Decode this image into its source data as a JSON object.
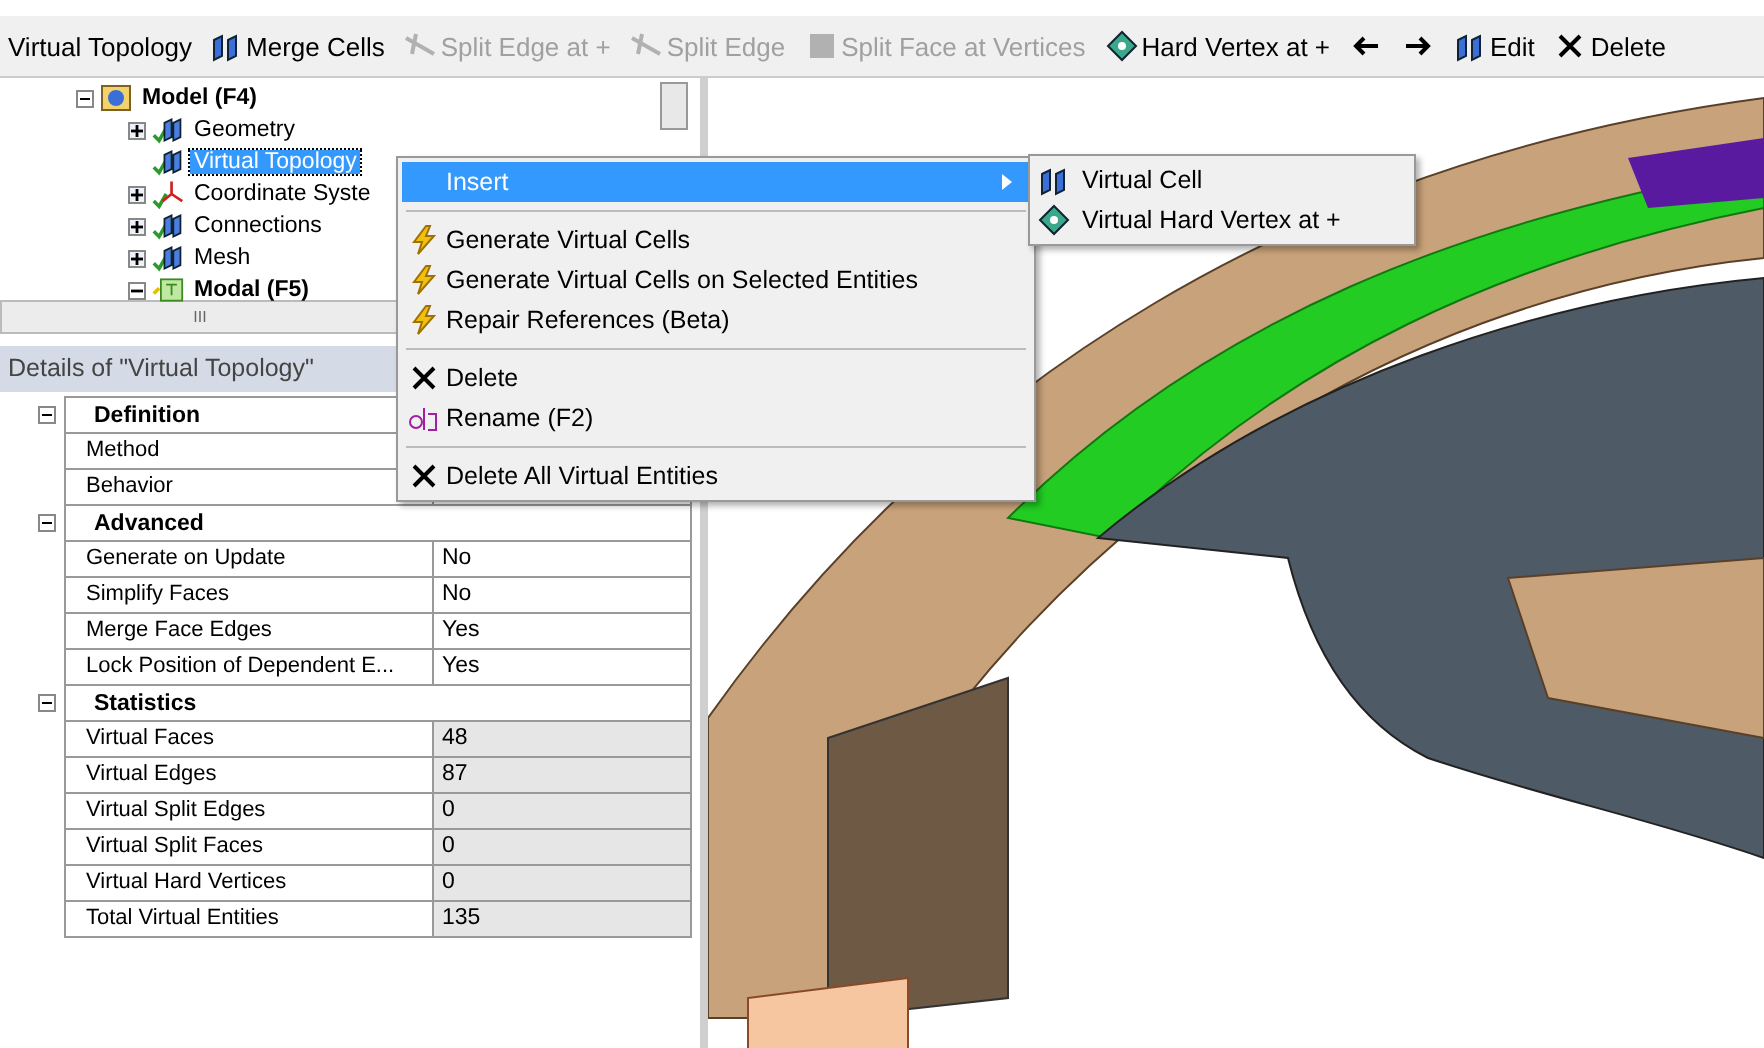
{
  "toolbar": {
    "title": "Virtual Topology",
    "buttons": [
      {
        "label": "Merge Cells",
        "kind": "cells",
        "disabled": false
      },
      {
        "label": "Split Edge at +",
        "kind": "split",
        "disabled": true
      },
      {
        "label": "Split Edge",
        "kind": "split",
        "disabled": true
      },
      {
        "label": "Split Face at Vertices",
        "kind": "face",
        "disabled": true
      },
      {
        "label": "Hard Vertex at +",
        "kind": "vertex",
        "disabled": false
      },
      {
        "kind": "back",
        "disabled": false
      },
      {
        "kind": "forward",
        "disabled": false
      },
      {
        "label": "Edit",
        "kind": "cells",
        "disabled": false
      },
      {
        "label": "Delete",
        "kind": "delete",
        "disabled": false
      }
    ]
  },
  "tree": {
    "items": [
      {
        "label": "Model (F4)",
        "kind": "model",
        "expanded": true,
        "selected": false,
        "children": [
          {
            "label": "Geometry",
            "kind": "part",
            "expanded": false,
            "selected": false
          },
          {
            "label": "Virtual Topology",
            "kind": "part",
            "selected": true
          },
          {
            "label": "Coordinate Syste",
            "kind": "coords",
            "expanded": false,
            "selected": false
          },
          {
            "label": "Connections",
            "kind": "part",
            "expanded": false,
            "selected": false
          },
          {
            "label": "Mesh",
            "kind": "part",
            "expanded": false,
            "selected": false
          },
          {
            "label": "Modal (F5)",
            "kind": "analysis",
            "expanded": true,
            "selected": false
          }
        ]
      }
    ],
    "scroll_thumb": "III"
  },
  "details": {
    "title": "Details of \"Virtual Topology\"",
    "sections": [
      {
        "name": "Definition",
        "expanded": true,
        "rows": [
          {
            "label": "Method"
          },
          {
            "label": "Behavior"
          }
        ]
      },
      {
        "name": "Advanced",
        "expanded": true,
        "rows": [
          {
            "label": "Generate on Update",
            "value": "No",
            "readonly": false
          },
          {
            "label": "Simplify Faces",
            "value": "No",
            "readonly": false
          },
          {
            "label": "Merge Face Edges",
            "value": "Yes",
            "readonly": false
          },
          {
            "label": "Lock Position of Dependent E...",
            "value": "Yes",
            "readonly": false
          }
        ]
      },
      {
        "name": "Statistics",
        "expanded": true,
        "rows": [
          {
            "label": "Virtual Faces",
            "value": "48",
            "readonly": true
          },
          {
            "label": "Virtual Edges",
            "value": "87",
            "readonly": true
          },
          {
            "label": "Virtual Split Edges",
            "value": "0",
            "readonly": true
          },
          {
            "label": "Virtual Split Faces",
            "value": "0",
            "readonly": true
          },
          {
            "label": "Virtual Hard Vertices",
            "value": "0",
            "readonly": true
          },
          {
            "label": "Total Virtual Entities",
            "value": "135",
            "readonly": true
          }
        ]
      }
    ]
  },
  "context_menu": {
    "groups": [
      [
        {
          "label": "Insert",
          "kind": "submenu",
          "selected": true
        }
      ],
      [
        {
          "label": "Generate Virtual Cells",
          "kind": "generate",
          "selected": false
        },
        {
          "label": "Generate Virtual Cells on Selected Entities",
          "kind": "generate",
          "selected": false
        },
        {
          "label": "Repair References (Beta)",
          "kind": "generate",
          "selected": false
        }
      ],
      [
        {
          "label": "Delete",
          "kind": "delete",
          "selected": false
        },
        {
          "label": "Rename (F2)",
          "kind": "rename",
          "selected": false
        }
      ],
      [
        {
          "label": "Delete All Virtual Entities",
          "kind": "delete",
          "selected": false
        }
      ]
    ],
    "submenu": [
      {
        "label": "Virtual Cell",
        "kind": "cells"
      },
      {
        "label": "Virtual Hard Vertex at +",
        "kind": "vertex"
      }
    ]
  }
}
